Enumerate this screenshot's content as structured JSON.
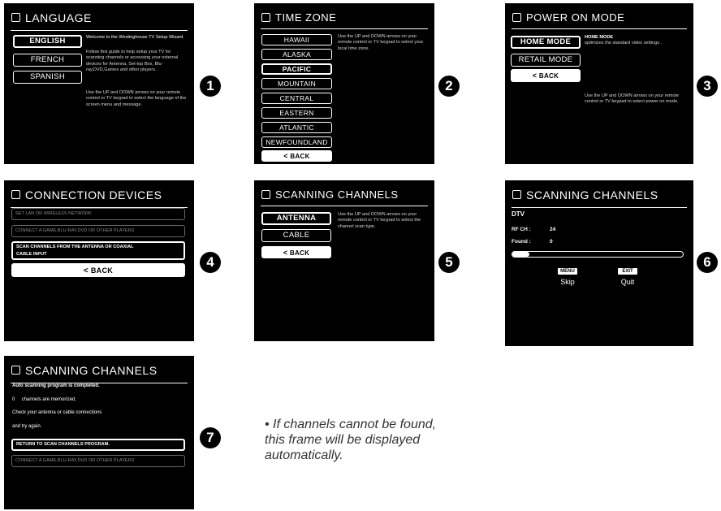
{
  "language": {
    "title": "LANGUAGE",
    "options": [
      "ENGLISH",
      "FRENCH",
      "SPANISH"
    ],
    "welcome": "Welcome to the Westinghouse TV Setup Wizard.",
    "guide": "Follow this guide to help setup your TV for scanning channels or accessing your external devices for Antenna, Set-top Box, Blu-ray,DVD,Games and other players.",
    "hint": "Use the UP and DOWN arrows on your remote control or TV keypad to select the language of the screen menu and message."
  },
  "timezone": {
    "title": "TIME ZONE",
    "options": [
      "HAWAII",
      "ALASKA",
      "PACIFIC",
      "MOUNTAIN",
      "CENTRAL",
      "EASTERN",
      "ATLANTIC",
      "NEWFOUNDLAND"
    ],
    "back": "BACK",
    "hint": "Use the UP and DOWN arrows on your remote control or TV keypad to select your local time zone."
  },
  "power": {
    "title": "POWER ON MODE",
    "options": [
      "HOME MODE",
      "RETAIL MODE"
    ],
    "back": "BACK",
    "desc_title": "HOME MODE",
    "desc": "optimizes the standard video settings .",
    "hint": "Use the UP and DOWN arrows on your remote control or TV keypad to select power on mode."
  },
  "connection": {
    "title": "CONNECTION DEVICES",
    "rows": [
      "SET LAN OR WIRELESS NETWORK",
      "CONNECT A GAME,BLU-RAY,DVD OR OTHER PLAYERS",
      "SCAN CHANNELS FROM THE ANTENNA OR COAXIAL",
      "CABLE INPUT"
    ],
    "back": "BACK"
  },
  "scan_select": {
    "title": "SCANNING CHANNELS",
    "options": [
      "ANTENNA",
      "CABLE"
    ],
    "back": "BACK",
    "hint": "Use the UP and DOWN arrows on your remote control or TV keypad to select the channel scan type."
  },
  "scan_progress": {
    "title": "SCANNING CHANNELS",
    "mode": "DTV",
    "rf_label": "RF CH :",
    "rf_value": "24",
    "found_label": "Found :",
    "found_value": "0",
    "progress": 0.1,
    "menu_key": "MENU",
    "menu_label": "Skip",
    "exit_key": "EXIT",
    "exit_label": "Quit"
  },
  "scan_done": {
    "title": "SCANNING CHANNELS",
    "line1": "Auto scanning program is completed.",
    "line2": "0     channels are memorized.",
    "line3": "Check your antenna or cable connections",
    "line4": "and try again.",
    "rows": [
      "RETURN TO SCAN CHANNELS PROGRAM.",
      "CONNECT A GAME,BLU-RAY,DVD OR OTHER PLAYERS"
    ]
  },
  "steps": [
    "1",
    "2",
    "3",
    "4",
    "5",
    "6",
    "7"
  ],
  "note": "• If channels cannot be found, this frame will be displayed automatically."
}
